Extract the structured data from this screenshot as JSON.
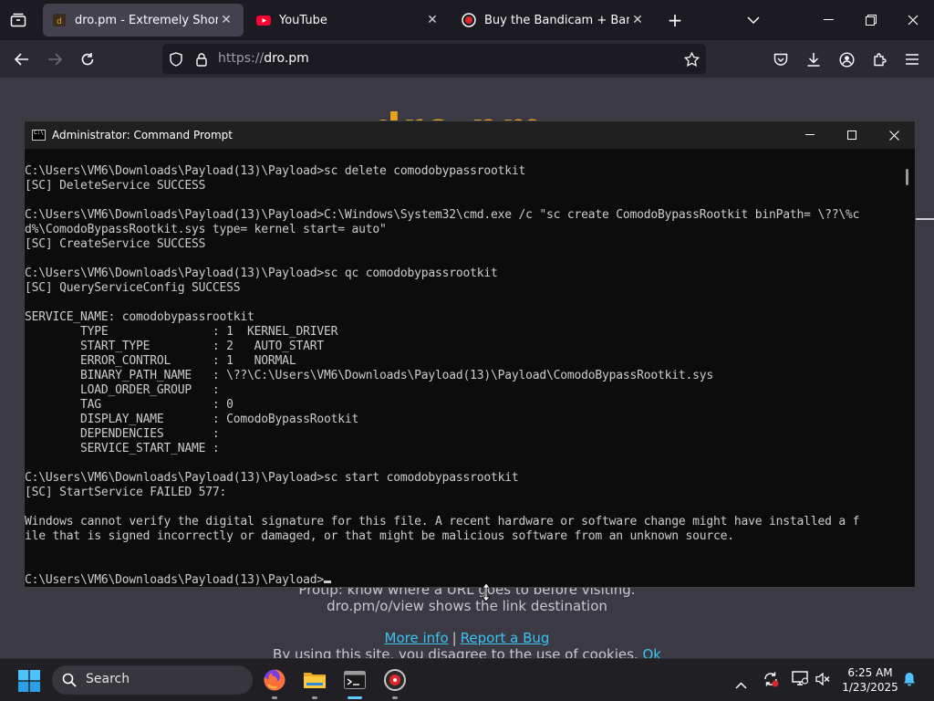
{
  "browser": {
    "tabs": [
      {
        "title": "dro.pm - Extremely Short Links",
        "active": true
      },
      {
        "title": "YouTube",
        "active": false
      },
      {
        "title": "Buy the Bandicam + Bandicut p",
        "active": false
      }
    ],
    "url_scheme": "https://",
    "url_host": "dro.pm"
  },
  "page": {
    "logo": "dro.pm",
    "text_line1": "Protip: know where a URL goes to before visiting.",
    "text_line2": "dro.pm/o/view shows the link destination",
    "more_info": "More info",
    "separator": "|",
    "report_bug": "Report a Bug",
    "cookie_text": "By using this site, you disagree to the use of cookies.",
    "cookie_ok": "Ok"
  },
  "cmd": {
    "title": "Administrator: Command Prompt",
    "lines": [
      "C:\\Users\\VM6\\Downloads\\Payload(13)\\Payload>sc delete comodobypassrootkit",
      "[SC] DeleteService SUCCESS",
      "",
      "C:\\Users\\VM6\\Downloads\\Payload(13)\\Payload>C:\\Windows\\System32\\cmd.exe /c \"sc create ComodoBypassRootkit binPath= \\??\\%c",
      "d%\\ComodoBypassRootkit.sys type= kernel start= auto\"",
      "[SC] CreateService SUCCESS",
      "",
      "C:\\Users\\VM6\\Downloads\\Payload(13)\\Payload>sc qc comodobypassrootkit",
      "[SC] QueryServiceConfig SUCCESS",
      "",
      "SERVICE_NAME: comodobypassrootkit",
      "        TYPE               : 1  KERNEL_DRIVER",
      "        START_TYPE         : 2   AUTO_START",
      "        ERROR_CONTROL      : 1   NORMAL",
      "        BINARY_PATH_NAME   : \\??\\C:\\Users\\VM6\\Downloads\\Payload(13)\\Payload\\ComodoBypassRootkit.sys",
      "        LOAD_ORDER_GROUP   :",
      "        TAG                : 0",
      "        DISPLAY_NAME       : ComodoBypassRootkit",
      "        DEPENDENCIES       :",
      "        SERVICE_START_NAME :",
      "",
      "C:\\Users\\VM6\\Downloads\\Payload(13)\\Payload>sc start comodobypassrootkit",
      "[SC] StartService FAILED 577:",
      "",
      "Windows cannot verify the digital signature for this file. A recent hardware or software change might have installed a f",
      "ile that is signed incorrectly or damaged, or that might be malicious software from an unknown source.",
      "",
      ""
    ],
    "prompt": "C:\\Users\\VM6\\Downloads\\Payload(13)\\Payload>"
  },
  "taskbar": {
    "search_label": "Search",
    "time": "6:25 AM",
    "date": "1/23/2025"
  }
}
